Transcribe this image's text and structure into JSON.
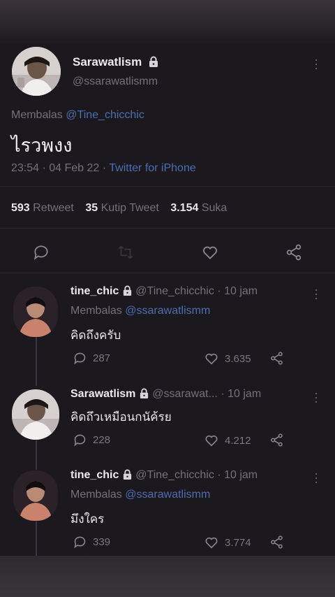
{
  "main_tweet": {
    "name": "Sarawatlism",
    "handle": "@ssarawatlismm",
    "reply_prefix": "Membalas",
    "reply_to": "@Tine_chicchic",
    "text": "ไรวพงง",
    "time_date": "23:54 · 04 Feb 22 ·",
    "source": "Twitter for iPhone",
    "stats": {
      "retweet_count": "593",
      "retweet_label": "Retweet",
      "quote_count": "35",
      "quote_label": "Kutip Tweet",
      "like_count": "3.154",
      "like_label": "Suka"
    }
  },
  "replies": [
    {
      "name": "tine_chic",
      "handle": "@Tine_chicchic",
      "time": "· 10 jam",
      "reply_prefix": "Membalas",
      "reply_to": "@ssarawatlismm",
      "text": "คิดถึงครับ",
      "reply_count": "287",
      "like_count": "3.635"
    },
    {
      "name": "Sarawatlism",
      "handle": "@ssarawat...",
      "time": "· 10 jam",
      "text": "คิดถึวเหมือนกนัค้รย",
      "reply_count": "228",
      "like_count": "4.212"
    },
    {
      "name": "tine_chic",
      "handle": "@Tine_chicchic",
      "time": "· 10 jam",
      "reply_prefix": "Membalas",
      "reply_to": "@ssarawatlismm",
      "text": "มึงใคร",
      "reply_count": "339",
      "like_count": "3.774"
    }
  ],
  "icons": [
    "lock-icon",
    "more-icon",
    "reply-icon",
    "retweet-icon",
    "like-icon",
    "share-icon"
  ],
  "colors": {
    "background": "#1b181e",
    "link": "#4f6db0",
    "muted": "#75707c"
  }
}
